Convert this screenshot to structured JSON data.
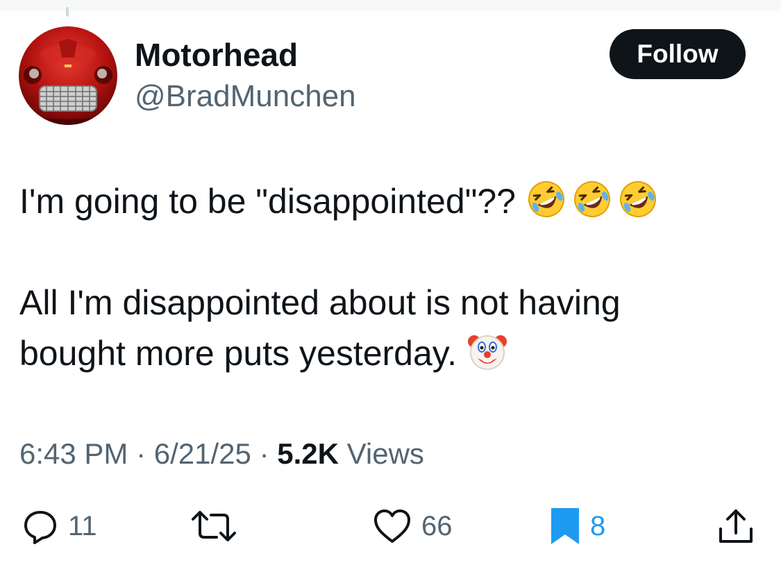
{
  "tweet": {
    "author": {
      "display_name": "Motorhead",
      "handle": "@BradMunchen",
      "avatar_icon": "red-car-avatar"
    },
    "follow_label": "Follow",
    "text_lines": [
      "I'm going to be \"disappointed\"??",
      "All I'm disappointed about is not having",
      "bought more puts yesterday."
    ],
    "emojis": {
      "line1": [
        "rolling-on-floor-laughing-emoji",
        "rolling-on-floor-laughing-emoji",
        "rolling-on-floor-laughing-emoji"
      ],
      "line2": [
        "clown-face-emoji"
      ]
    },
    "meta": {
      "time": "6:43 PM",
      "separator": "·",
      "date": "6/21/25",
      "views_count": "5.2K",
      "views_label": "Views"
    },
    "actions": {
      "replies": "11",
      "reposts": "",
      "likes": "66",
      "bookmarks": "8"
    },
    "colors": {
      "primary_text": "#0f1419",
      "secondary_text": "#536471",
      "bookmark_active": "#1d9bf0",
      "follow_button_bg": "#0f1419"
    }
  }
}
